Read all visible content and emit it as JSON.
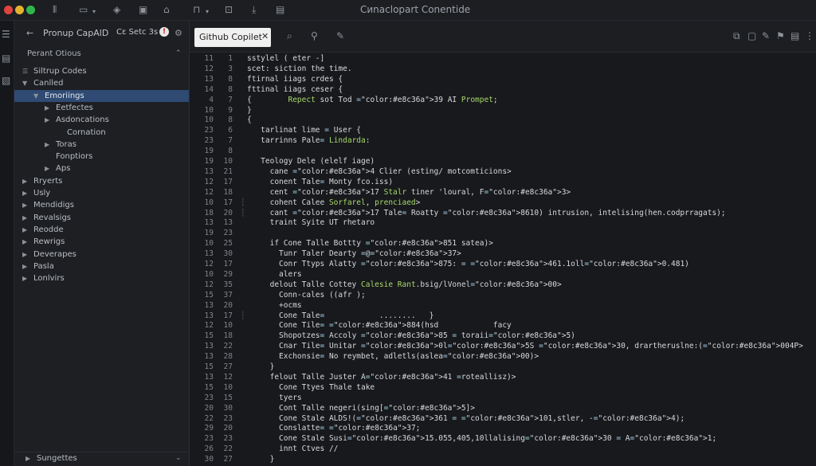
{
  "window": {
    "title": "Cиnaclopart Conentide",
    "dots": [
      "#e0443e",
      "#e6b22e",
      "#2fb84a"
    ],
    "toolbar_icons": [
      "menu-icon",
      "panel-icon",
      "chevron-down-icon",
      "shield-icon",
      "save-icon",
      "home-icon",
      "layout-icon",
      "chevron-down-icon",
      "bookmark-icon",
      "download-icon",
      "document-icon"
    ]
  },
  "activity": {
    "icons": [
      "menu-icon",
      "clipboard-icon",
      "file-icon"
    ]
  },
  "sidebar": {
    "header": {
      "back": "←",
      "title": "Pronup CapAlD",
      "subtitle": "Cε Setc 3s",
      "alert": "!",
      "settings": "⚙"
    },
    "section": "Perant Otious",
    "tree": [
      {
        "label": "Siltrup Codes",
        "indent": 1,
        "arrow": "expanded"
      },
      {
        "label": "Canlled",
        "indent": 1,
        "arrow": "down"
      },
      {
        "label": "Emoriings",
        "indent": 2,
        "arrow": "down",
        "selected": true
      },
      {
        "label": "Eetfectes",
        "indent": 3,
        "arrow": "right"
      },
      {
        "label": "Asdoncations",
        "indent": 3,
        "arrow": "right"
      },
      {
        "label": "Cornation",
        "indent": 4,
        "arrow": "none"
      },
      {
        "label": "Toras",
        "indent": 3,
        "arrow": "right"
      },
      {
        "label": "Fonptiors",
        "indent": 3,
        "arrow": "none"
      },
      {
        "label": "Aps",
        "indent": 3,
        "arrow": "right"
      },
      {
        "label": "Rryerts",
        "indent": 1,
        "arrow": "right"
      },
      {
        "label": "Usly",
        "indent": 1,
        "arrow": "right"
      },
      {
        "label": "Mendidigs",
        "indent": 1,
        "arrow": "right"
      },
      {
        "label": "Revalsigs",
        "indent": 1,
        "arrow": "right"
      },
      {
        "label": "Reodde",
        "indent": 1,
        "arrow": "right"
      },
      {
        "label": "Rewrigs",
        "indent": 1,
        "arrow": "right"
      },
      {
        "label": "Deverapes",
        "indent": 1,
        "arrow": "right"
      },
      {
        "label": "Pasla",
        "indent": 1,
        "arrow": "right"
      },
      {
        "label": "Lonlvirs",
        "indent": 1,
        "arrow": "right"
      }
    ],
    "footer": "Sungettes"
  },
  "editor": {
    "tab": {
      "label": "Github Copilet",
      "close": "✕"
    },
    "tab_icons": [
      "search-icon",
      "search-icon",
      "edit-icon"
    ],
    "right_icons": [
      "copy-icon",
      "folder-icon",
      "edit-icon",
      "pin-icon",
      "bookmark-icon",
      "more-icon"
    ],
    "lines": [
      {
        "a": "11",
        "b": "1",
        "g": "",
        "t": "sstylel ( eter -]"
      },
      {
        "a": "12",
        "b": "3",
        "g": "",
        "t": "scet: siction the time."
      },
      {
        "a": "13",
        "b": "8",
        "g": "",
        "t": "ftirnal iiags crdes {"
      },
      {
        "a": "14",
        "b": "8",
        "g": "",
        "t": "fttinal iiags ceser {"
      },
      {
        "a": "4",
        "b": "7",
        "g": "",
        "t": "{        Repect sot Tod 39 AI Prompet;"
      },
      {
        "a": "10",
        "b": "9",
        "g": "",
        "t": "}"
      },
      {
        "a": "10",
        "b": "8",
        "g": "",
        "t": "{"
      },
      {
        "a": "23",
        "b": "6",
        "g": "",
        "t": "   tarlinat lime = User {"
      },
      {
        "a": "23",
        "b": "7",
        "g": "",
        "t": "   tarrinns Pale= Lindarda:"
      },
      {
        "a": "19",
        "b": "8",
        "g": "",
        "t": ""
      },
      {
        "a": "19",
        "b": "10",
        "g": "",
        "t": "   Teology Dele (elelf iage)"
      },
      {
        "a": "13",
        "b": "21",
        "g": "",
        "t": "     cane 4 Clier (esting/ motcomticions>"
      },
      {
        "a": "12",
        "b": "17",
        "g": "",
        "t": "     conent Tale= Monty fco.iss)"
      },
      {
        "a": "12",
        "b": "18",
        "g": "",
        "t": "     cent 17 Stalr tiner 'loural, F3>"
      },
      {
        "a": "10",
        "b": "17",
        "g": "┆",
        "t": "     cohent Calee Sorfarel, prenciaed>"
      },
      {
        "a": "18",
        "b": "20",
        "g": "┆",
        "t": "     cant 17 Tale= Roatty 8610) intrusion, intelising(hen.codprragats);"
      },
      {
        "a": "13",
        "b": "13",
        "g": "",
        "t": "     traint Syite UT rhetaro"
      },
      {
        "a": "19",
        "b": "23",
        "g": "",
        "t": ""
      },
      {
        "a": "10",
        "b": "25",
        "g": "",
        "t": "     if Cone Talle Bottty 851 satea)>"
      },
      {
        "a": "13",
        "b": "30",
        "g": "",
        "t": "       Tunr Taler Dearty =@37>"
      },
      {
        "a": "12",
        "b": "17",
        "g": "",
        "t": "       Conr Ttyps Alatty 875: = 461.1oll0.481)"
      },
      {
        "a": "10",
        "b": "29",
        "g": "",
        "t": "       alers"
      },
      {
        "a": "12",
        "b": "35",
        "g": "",
        "t": "     delout Talle Cottey Calesie Rant.bsig/lVonel00>"
      },
      {
        "a": "15",
        "b": "37",
        "g": "",
        "t": "       Conn-cales ((afr );"
      },
      {
        "a": "13",
        "b": "20",
        "g": "",
        "t": "       +ocms"
      },
      {
        "a": "13",
        "b": "17",
        "g": "┆",
        "t": "       Cone Tale=            ........   }"
      },
      {
        "a": "12",
        "b": "10",
        "g": "",
        "t": "       Cone Tile= 884(hsd            facy"
      },
      {
        "a": "15",
        "b": "18",
        "g": "",
        "t": "       Shopotzes= Accoly 85 = toraii5)"
      },
      {
        "a": "13",
        "b": "22",
        "g": "",
        "t": "       Cnar Tile= Unitar 0l5S 30, drartheruslne:(004P>"
      },
      {
        "a": "13",
        "b": "28",
        "g": "",
        "t": "       Exchonsie= No reymbet, adletls(aslea00)>"
      },
      {
        "a": "15",
        "b": "27",
        "g": "",
        "t": "     }"
      },
      {
        "a": "13",
        "b": "12",
        "g": "",
        "t": "     felout Talle Juster A41 =roteallisz)>"
      },
      {
        "a": "15",
        "b": "10",
        "g": "",
        "t": "       Cone Ttyes Thale take"
      },
      {
        "a": "23",
        "b": "15",
        "g": "",
        "t": "       tyers"
      },
      {
        "a": "20",
        "b": "30",
        "g": "",
        "t": "       Cont Talle negeri(sing[5]>"
      },
      {
        "a": "22",
        "b": "23",
        "g": "",
        "t": "       Cone Stale ALDS!(361 = 101,stler, -4);"
      },
      {
        "a": "29",
        "b": "20",
        "g": "",
        "t": "       Conslatte= 37;"
      },
      {
        "a": "23",
        "b": "23",
        "g": "",
        "t": "       Cone Stale Susi15.055,405,10llalising30 = A1;"
      },
      {
        "a": "26",
        "b": "22",
        "g": "",
        "t": "       innt Ctves //"
      },
      {
        "a": "30",
        "b": "27",
        "g": "",
        "t": "     }"
      }
    ]
  }
}
